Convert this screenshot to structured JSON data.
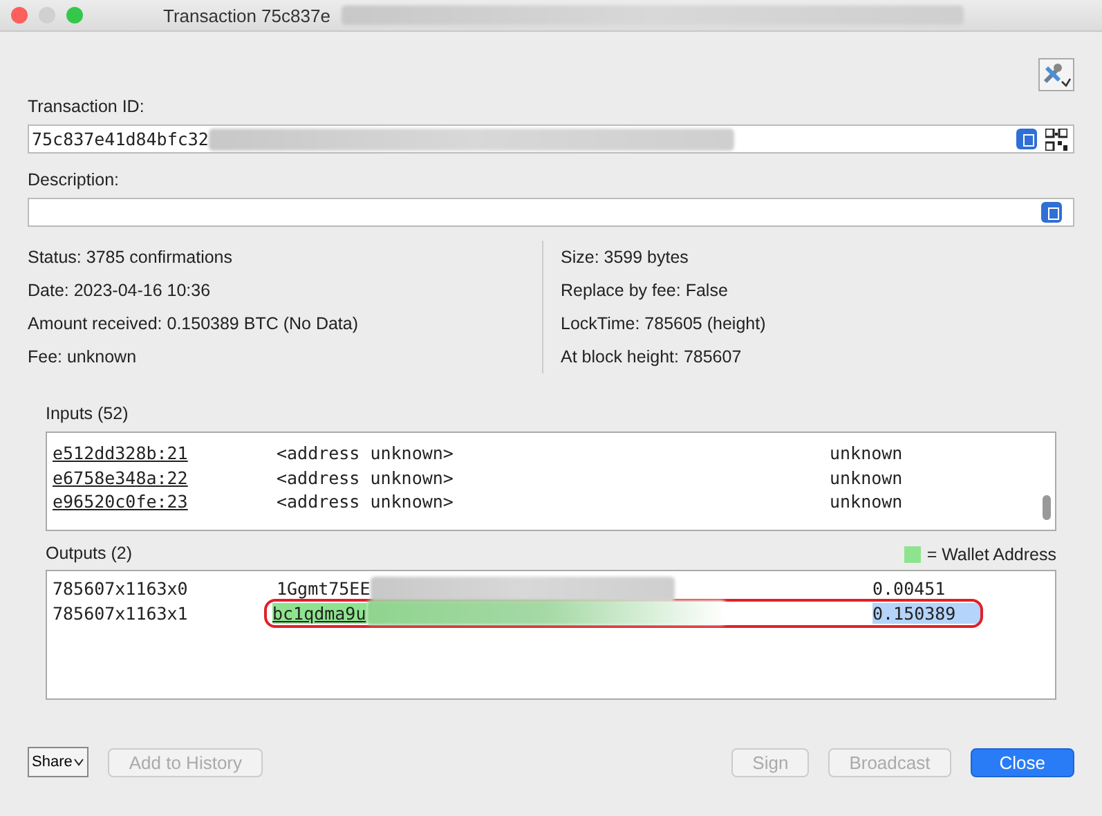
{
  "window": {
    "title": "Transaction 75c837e"
  },
  "transaction_id": {
    "label": "Transaction ID:",
    "value": "75c837e41d84bfc32"
  },
  "description": {
    "label": "Description:"
  },
  "details_left": [
    "Status: 3785 confirmations",
    "Date: 2023-04-16 10:36",
    "Amount received: 0.150389 BTC (No Data)",
    "Fee: unknown"
  ],
  "details_right": [
    "Size: 3599 bytes",
    "Replace by fee: False",
    "LockTime: 785605 (height)",
    "At block height: 785607"
  ],
  "inputs": {
    "label": "Inputs (52)",
    "rows": [
      {
        "outpoint": "e512dd328b:21",
        "address": "<address unknown>",
        "amount": "unknown"
      },
      {
        "outpoint": "e6758e348a:22",
        "address": "<address unknown>",
        "amount": "unknown"
      },
      {
        "outpoint": "e96520c0fe:23",
        "address": "<address unknown>",
        "amount": "unknown"
      }
    ]
  },
  "outputs": {
    "label": "Outputs (2)",
    "legend": "= Wallet Address",
    "rows": [
      {
        "outpoint": "785607x1163x0",
        "address": "1Ggmt75EE",
        "amount": "0.00451",
        "wallet": false,
        "selected": false,
        "marked": false
      },
      {
        "outpoint": "785607x1163x1",
        "address": "bc1qdma9u",
        "amount": "0.150389",
        "wallet": true,
        "selected": true,
        "marked": true
      }
    ]
  },
  "buttons": [
    {
      "kind": "share",
      "label": "Share",
      "disabled": false
    },
    {
      "kind": "normal",
      "label": "Add to History",
      "disabled": true
    },
    {
      "kind": "spacer"
    },
    {
      "kind": "normal",
      "label": "Sign",
      "disabled": true
    },
    {
      "kind": "normal",
      "label": "Broadcast",
      "disabled": true
    },
    {
      "kind": "default",
      "label": "Close",
      "disabled": false
    }
  ]
}
